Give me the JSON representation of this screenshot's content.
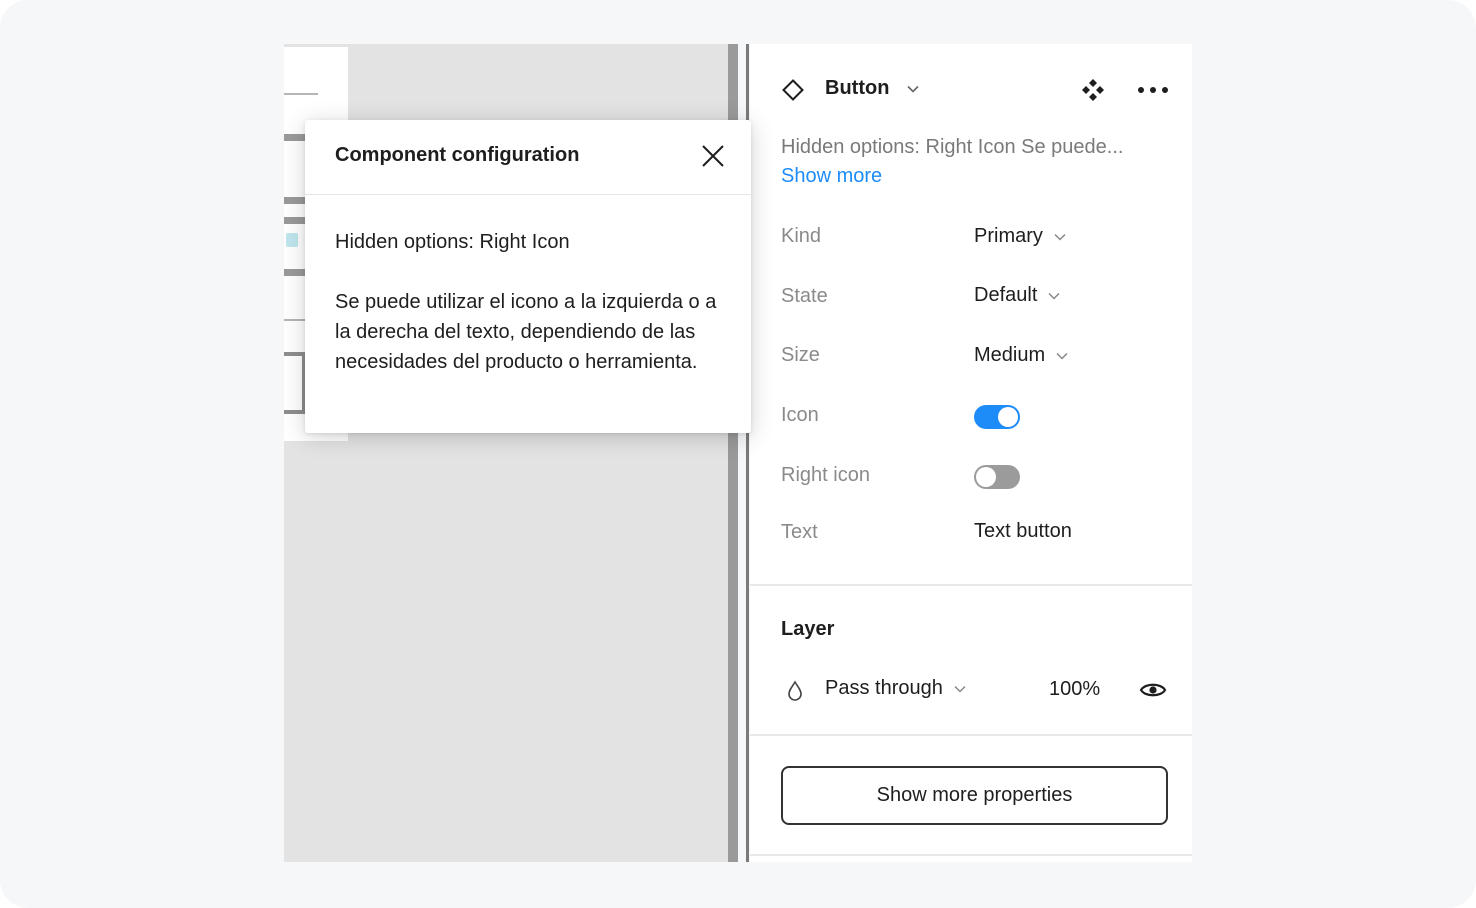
{
  "panel": {
    "component_name": "Button",
    "description": "Hidden options: Right Icon Se puede...",
    "show_more_label": "Show more",
    "properties": [
      {
        "label": "Kind",
        "value": "Primary"
      },
      {
        "label": "State",
        "value": "Default"
      },
      {
        "label": "Size",
        "value": "Medium"
      }
    ],
    "icon_toggle": {
      "label": "Icon",
      "on": true
    },
    "right_icon_toggle": {
      "label": "Right icon",
      "on": false
    },
    "text_prop": {
      "label": "Text",
      "value": "Text button"
    },
    "layer": {
      "title": "Layer",
      "blend_mode": "Pass through",
      "opacity": "100%"
    },
    "show_more_properties_label": "Show more properties"
  },
  "popover": {
    "title": "Component configuration",
    "line1": "Hidden options: Right Icon",
    "line2": "Se puede utilizar el icono a la izquierda o a la derecha del texto, dependiendo de las necesidades del producto o herramienta."
  },
  "colors": {
    "accent": "#1d8cf8",
    "toggle_off": "#9b9b9b",
    "canvas": "#e3e3e3",
    "background": "#f6f7f9"
  },
  "icons": [
    "diamond-icon",
    "chevron-down-icon",
    "four-diamond-icon",
    "more-icon",
    "close-icon",
    "drop-icon",
    "eye-icon"
  ]
}
